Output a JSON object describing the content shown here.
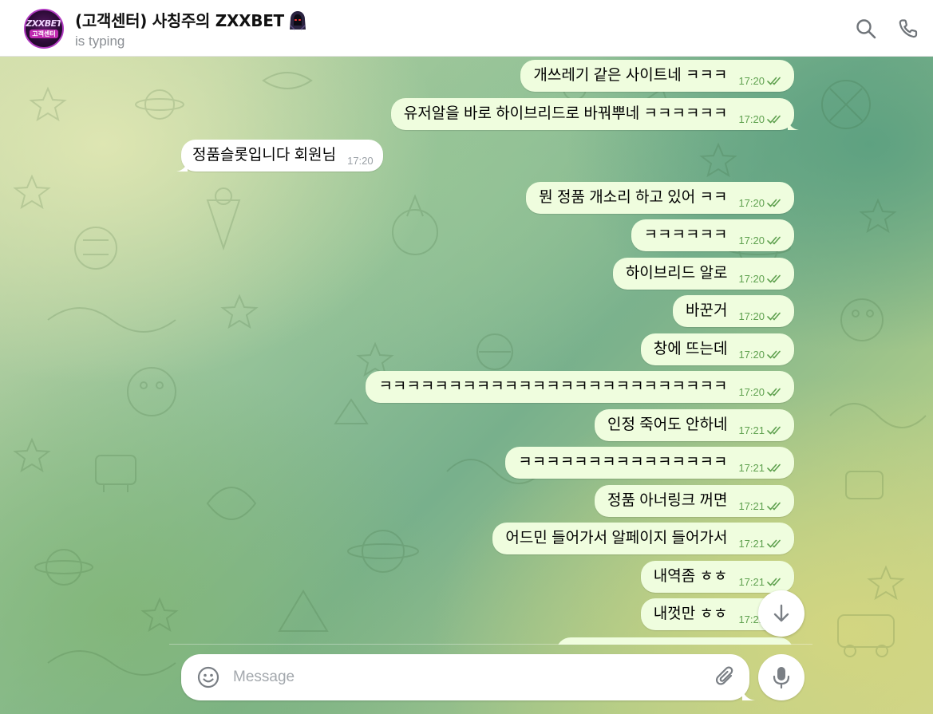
{
  "header": {
    "title": "(고객센터) 사칭주의 ZXXBET",
    "status": "is typing",
    "avatar_text_top": "ZXXBET",
    "avatar_text_bottom": "고객센터"
  },
  "messages": [
    {
      "dir": "out",
      "text": "개쓰레기 같은 사이트네 ㅋㅋㅋ",
      "time": "17:20"
    },
    {
      "dir": "out",
      "text": "유저알을 바로 하이브리드로 바꿔뿌네 ㅋㅋㅋㅋㅋㅋ",
      "time": "17:20"
    },
    {
      "dir": "in",
      "text": "정품슬롯입니다 회원님",
      "time": "17:20"
    },
    {
      "dir": "out",
      "text": "뭔 정품 개소리 하고 있어 ㅋㅋ",
      "time": "17:20"
    },
    {
      "dir": "out",
      "text": "ㅋㅋㅋㅋㅋㅋ",
      "time": "17:20"
    },
    {
      "dir": "out",
      "text": "하이브리드 알로",
      "time": "17:20"
    },
    {
      "dir": "out",
      "text": "바꾼거",
      "time": "17:20"
    },
    {
      "dir": "out",
      "text": "창에 뜨는데",
      "time": "17:20"
    },
    {
      "dir": "out",
      "text": "ㅋㅋㅋㅋㅋㅋㅋㅋㅋㅋㅋㅋㅋㅋㅋㅋㅋㅋㅋㅋㅋㅋㅋㅋㅋ",
      "time": "17:20"
    },
    {
      "dir": "out",
      "text": "인정 죽어도 안하네",
      "time": "17:21"
    },
    {
      "dir": "out",
      "text": "ㅋㅋㅋㅋㅋㅋㅋㅋㅋㅋㅋㅋㅋㅋㅋ",
      "time": "17:21"
    },
    {
      "dir": "out",
      "text": "정품 아너링크 꺼면",
      "time": "17:21"
    },
    {
      "dir": "out",
      "text": "어드민 들어가서  알페이지 들어가서",
      "time": "17:21"
    },
    {
      "dir": "out",
      "text": "내역좀 ㅎㅎ",
      "time": "17:21"
    },
    {
      "dir": "out",
      "text": "내껏만 ㅎㅎ",
      "time": "17:21"
    }
  ],
  "composer": {
    "placeholder": "Message"
  },
  "icons": {
    "header": [
      "search-icon",
      "phone-icon"
    ],
    "composer": [
      "emoji-icon",
      "attach-icon",
      "mic-icon"
    ],
    "scroll": "arrow-down-icon",
    "read_receipt": "double-check-icon"
  },
  "colors": {
    "outgoing_bubble": "#effdde",
    "incoming_bubble": "#ffffff",
    "outgoing_time": "#5fa14f",
    "status_text": "#8b8f94"
  }
}
